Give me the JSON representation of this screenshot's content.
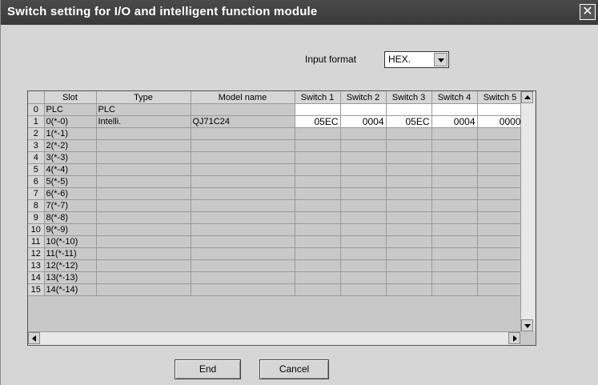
{
  "window": {
    "title": "Switch setting for I/O and intelligent function module",
    "close_label": "✕"
  },
  "input_format": {
    "label": "Input format",
    "selected": "HEX."
  },
  "grid": {
    "headers": [
      "",
      "Slot",
      "Type",
      "Model name",
      "Switch 1",
      "Switch 2",
      "Switch 3",
      "Switch 4",
      "Switch 5"
    ],
    "rows": [
      {
        "no": "0",
        "slot": "PLC",
        "type": "PLC",
        "model": "",
        "s1": "",
        "s2": "",
        "s3": "",
        "s4": "",
        "s5": ""
      },
      {
        "no": "1",
        "slot": "0(*-0)",
        "type": "Intelli.",
        "model": "QJ71C24",
        "s1": "05EC",
        "s2": "0004",
        "s3": "05EC",
        "s4": "0004",
        "s5": "0000"
      },
      {
        "no": "2",
        "slot": "1(*-1)",
        "type": "",
        "model": "",
        "s1": "",
        "s2": "",
        "s3": "",
        "s4": "",
        "s5": ""
      },
      {
        "no": "3",
        "slot": "2(*-2)",
        "type": "",
        "model": "",
        "s1": "",
        "s2": "",
        "s3": "",
        "s4": "",
        "s5": ""
      },
      {
        "no": "4",
        "slot": "3(*-3)",
        "type": "",
        "model": "",
        "s1": "",
        "s2": "",
        "s3": "",
        "s4": "",
        "s5": ""
      },
      {
        "no": "5",
        "slot": "4(*-4)",
        "type": "",
        "model": "",
        "s1": "",
        "s2": "",
        "s3": "",
        "s4": "",
        "s5": ""
      },
      {
        "no": "6",
        "slot": "5(*-5)",
        "type": "",
        "model": "",
        "s1": "",
        "s2": "",
        "s3": "",
        "s4": "",
        "s5": ""
      },
      {
        "no": "7",
        "slot": "6(*-6)",
        "type": "",
        "model": "",
        "s1": "",
        "s2": "",
        "s3": "",
        "s4": "",
        "s5": ""
      },
      {
        "no": "8",
        "slot": "7(*-7)",
        "type": "",
        "model": "",
        "s1": "",
        "s2": "",
        "s3": "",
        "s4": "",
        "s5": ""
      },
      {
        "no": "9",
        "slot": "8(*-8)",
        "type": "",
        "model": "",
        "s1": "",
        "s2": "",
        "s3": "",
        "s4": "",
        "s5": ""
      },
      {
        "no": "10",
        "slot": "9(*-9)",
        "type": "",
        "model": "",
        "s1": "",
        "s2": "",
        "s3": "",
        "s4": "",
        "s5": ""
      },
      {
        "no": "11",
        "slot": "10(*-10)",
        "type": "",
        "model": "",
        "s1": "",
        "s2": "",
        "s3": "",
        "s4": "",
        "s5": ""
      },
      {
        "no": "12",
        "slot": "11(*-11)",
        "type": "",
        "model": "",
        "s1": "",
        "s2": "",
        "s3": "",
        "s4": "",
        "s5": ""
      },
      {
        "no": "13",
        "slot": "12(*-12)",
        "type": "",
        "model": "",
        "s1": "",
        "s2": "",
        "s3": "",
        "s4": "",
        "s5": ""
      },
      {
        "no": "14",
        "slot": "13(*-13)",
        "type": "",
        "model": "",
        "s1": "",
        "s2": "",
        "s3": "",
        "s4": "",
        "s5": ""
      },
      {
        "no": "15",
        "slot": "14(*-14)",
        "type": "",
        "model": "",
        "s1": "",
        "s2": "",
        "s3": "",
        "s4": "",
        "s5": ""
      }
    ]
  },
  "buttons": {
    "end": "End",
    "cancel": "Cancel"
  }
}
